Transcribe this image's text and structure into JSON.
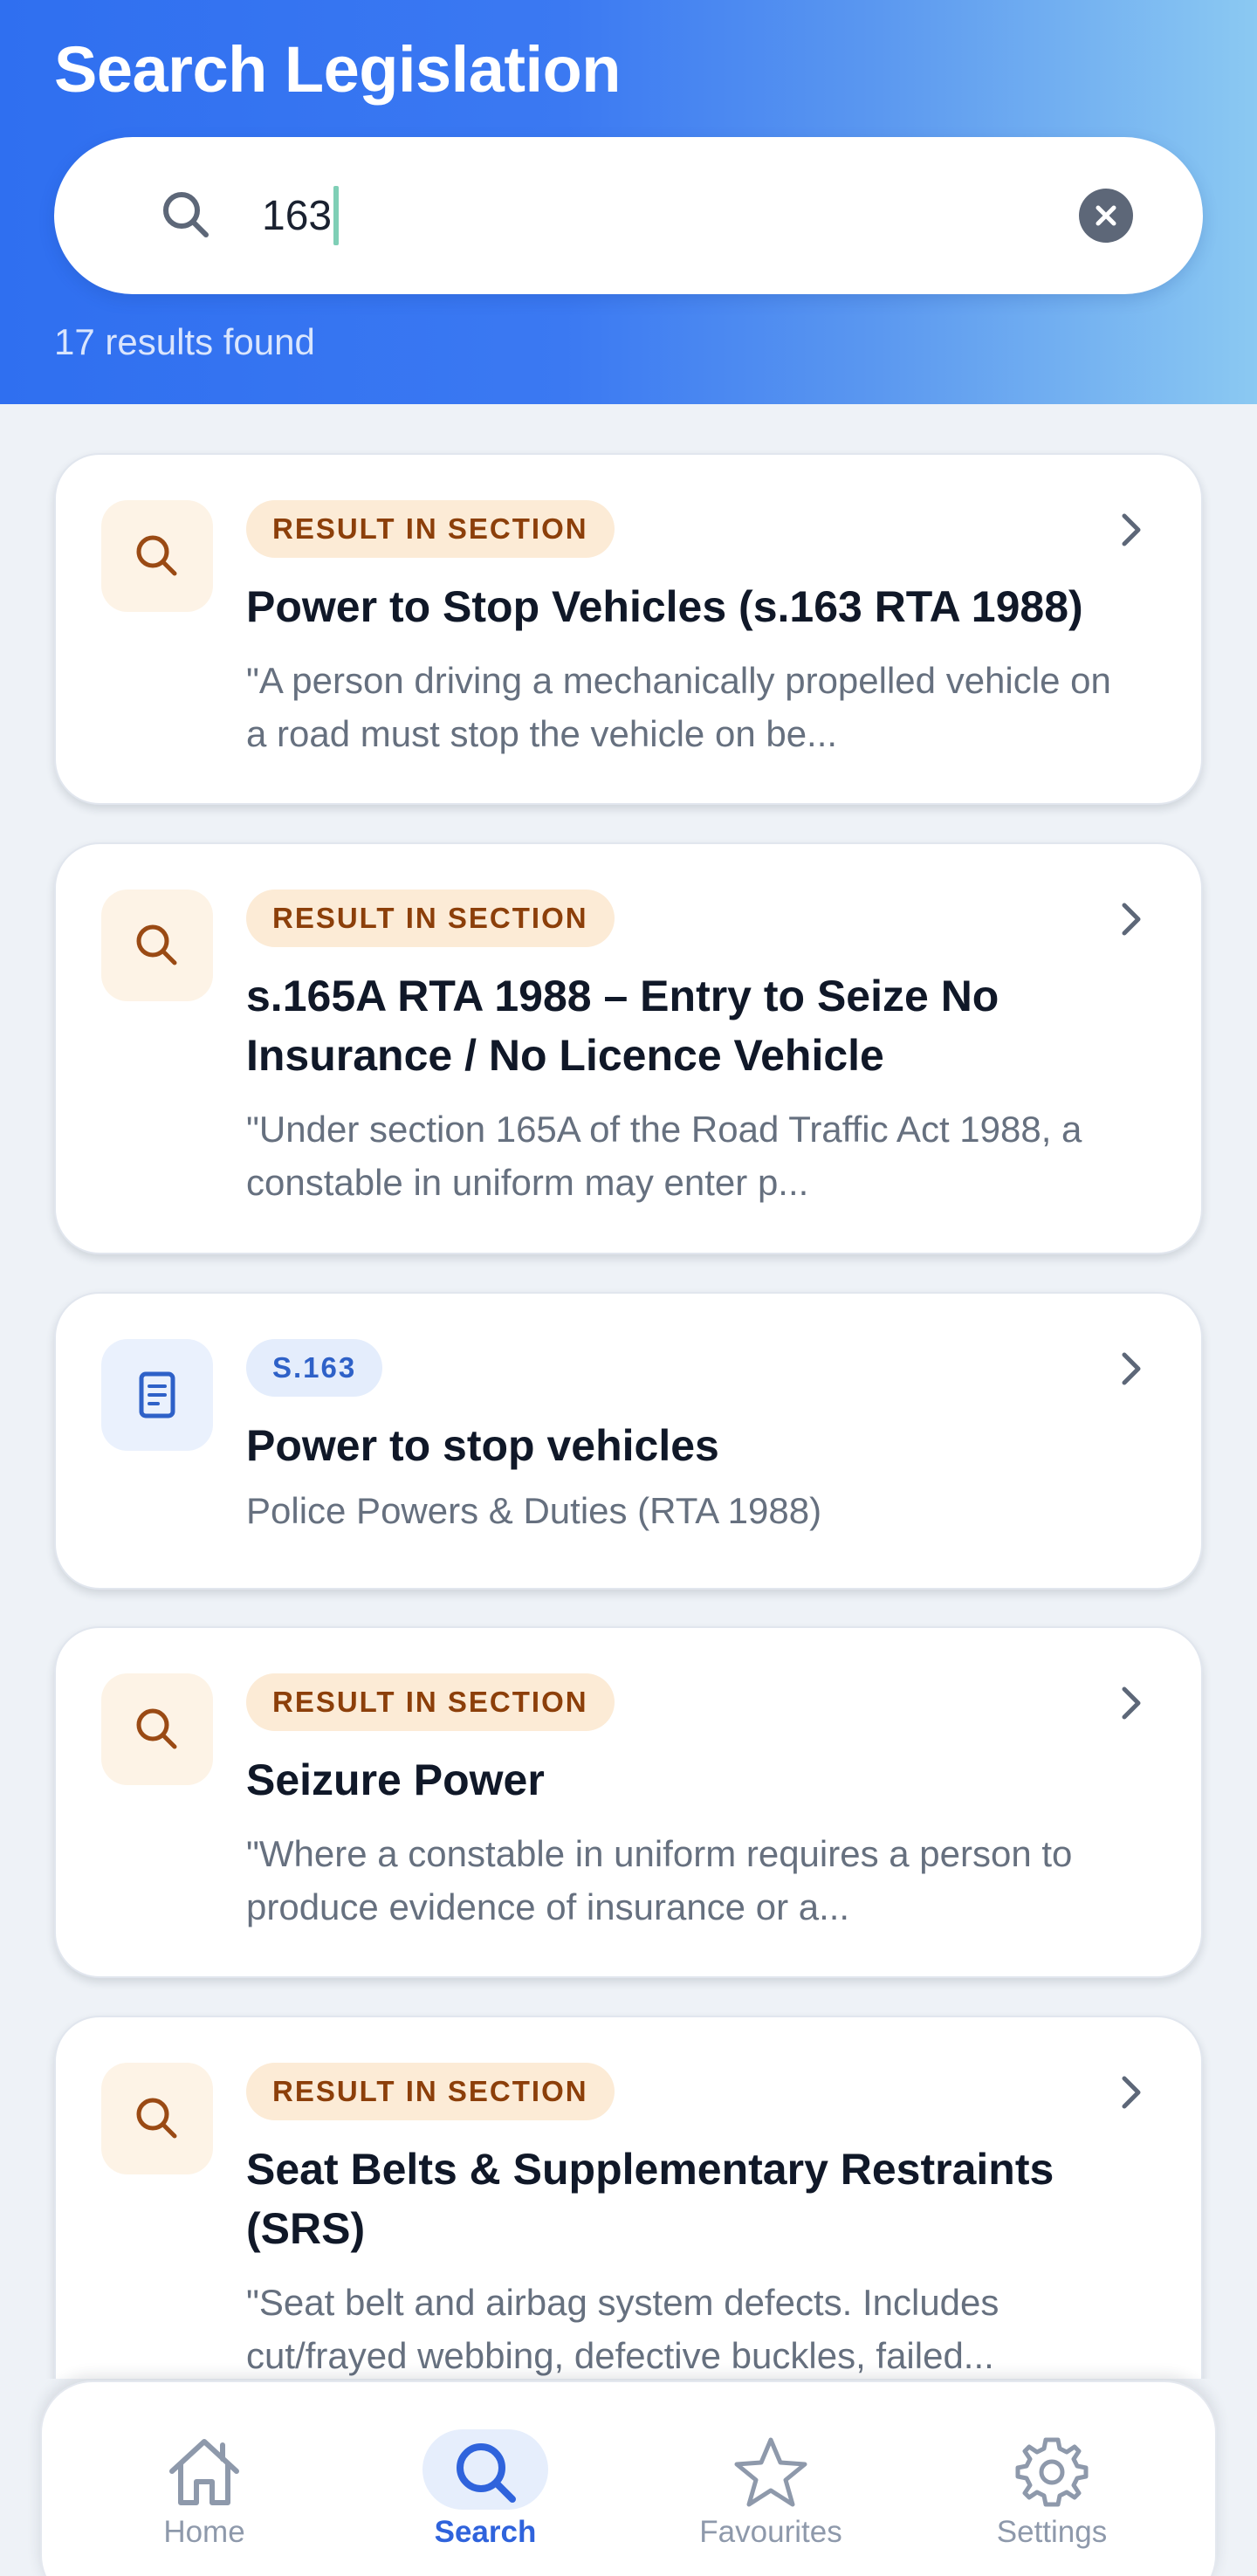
{
  "header": {
    "title": "Search Legislation",
    "results_count": "17 results found"
  },
  "search": {
    "value": "163",
    "placeholder": "",
    "search_icon": "search-icon",
    "clear_icon": "close-circle-icon"
  },
  "colors": {
    "accent_blue": "#2f6ff0",
    "badge_orange_bg": "#fcebd6",
    "badge_orange_text": "#8c3f0a",
    "badge_blue_bg": "#e4edfc",
    "badge_blue_text": "#2e61c8"
  },
  "results": [
    {
      "badge": "RESULT IN SECTION",
      "icon": "search-icon",
      "title": "Power to Stop Vehicles (s.163 RTA 1988)",
      "snippet": "\"A person driving a mechanically propelled vehicle on a road must stop the vehicle on be..."
    },
    {
      "badge": "RESULT IN SECTION",
      "icon": "search-icon",
      "title": "s.165A RTA 1988 – Entry to Seize No Insurance / No Licence Vehicle",
      "snippet": "\"Under section 165A of the Road Traffic Act 1988, a constable in uniform may enter p..."
    },
    {
      "badge": "S.163",
      "icon": "document-icon",
      "title": "Power to stop vehicles",
      "snippet": "Police Powers & Duties (RTA 1988)"
    },
    {
      "badge": "RESULT IN SECTION",
      "icon": "search-icon",
      "title": "Seizure Power",
      "snippet": "\"Where a constable in uniform requires a person to produce evidence of insurance or a..."
    },
    {
      "badge": "RESULT IN SECTION",
      "icon": "search-icon",
      "title": "Seat Belts & Supplementary Restraints (SRS)",
      "snippet": "\"Seat belt and airbag system defects. Includes cut/frayed webbing, defective buckles, failed..."
    }
  ],
  "nav": {
    "items": [
      {
        "label": "Home",
        "icon": "home-icon",
        "active": false
      },
      {
        "label": "Search",
        "icon": "search-icon",
        "active": true
      },
      {
        "label": "Favourites",
        "icon": "star-icon",
        "active": false
      },
      {
        "label": "Settings",
        "icon": "gear-icon",
        "active": false
      }
    ]
  }
}
